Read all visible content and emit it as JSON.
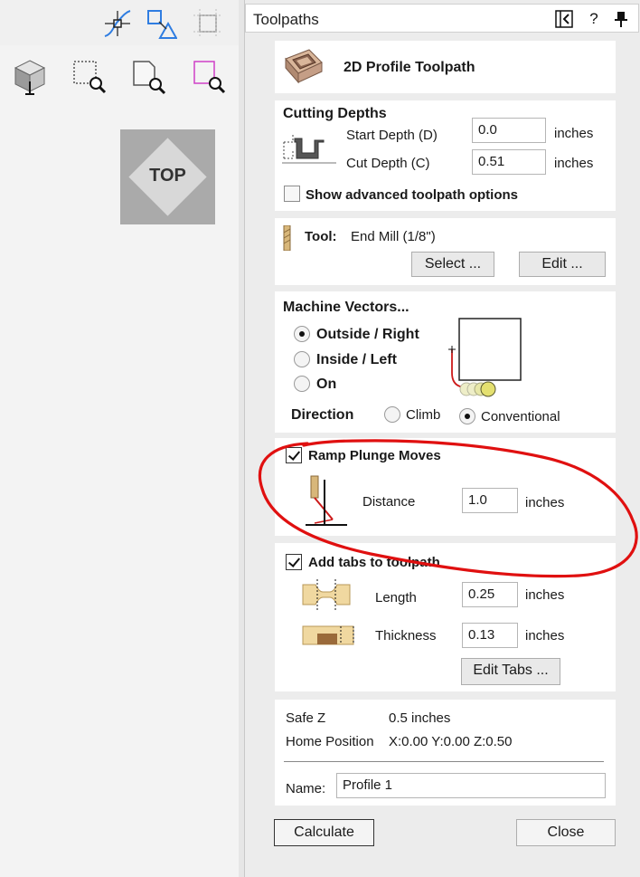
{
  "panel": {
    "title": "Toolpaths",
    "help_label": "?"
  },
  "view": {
    "orientation_label": "TOP"
  },
  "toolpath_header": {
    "title": "2D Profile Toolpath"
  },
  "cutting_depths": {
    "title": "Cutting Depths",
    "start_depth_label": "Start Depth (D)",
    "start_depth_value": "0.0",
    "start_depth_unit": "inches",
    "cut_depth_label": "Cut Depth (C)",
    "cut_depth_value": "0.51",
    "cut_depth_unit": "inches",
    "advanced_label": "Show advanced toolpath options",
    "advanced_checked": false
  },
  "tool": {
    "label": "Tool:",
    "name": "End Mill (1/8\")",
    "select_label": "Select ...",
    "edit_label": "Edit ..."
  },
  "machine_vectors": {
    "title": "Machine Vectors...",
    "options": [
      "Outside / Right",
      "Inside / Left",
      "On"
    ],
    "selected": "Outside / Right",
    "direction_label": "Direction",
    "direction_options": [
      "Climb",
      "Conventional"
    ],
    "direction_selected": "Conventional"
  },
  "ramp": {
    "label": "Ramp Plunge Moves",
    "checked": true,
    "distance_label": "Distance",
    "distance_value": "1.0",
    "distance_unit": "inches"
  },
  "tabs": {
    "label": "Add tabs to toolpath",
    "checked": true,
    "length_label": "Length",
    "length_value": "0.25",
    "length_unit": "inches",
    "thickness_label": "Thickness",
    "thickness_value": "0.13",
    "thickness_unit": "inches",
    "edit_tabs_label": "Edit Tabs ..."
  },
  "summary": {
    "safe_z_label": "Safe Z",
    "safe_z_value": "0.5 inches",
    "home_label": "Home Position",
    "home_value": "X:0.00 Y:0.00 Z:0.50",
    "name_label": "Name:",
    "name_value": "Profile 1"
  },
  "footer": {
    "calculate_label": "Calculate",
    "close_label": "Close"
  },
  "colors": {
    "annotation": "#e01010",
    "accent_blue": "#2f7de1",
    "accent_pink": "#d040c8",
    "tool_wood": "#d8b77a"
  }
}
